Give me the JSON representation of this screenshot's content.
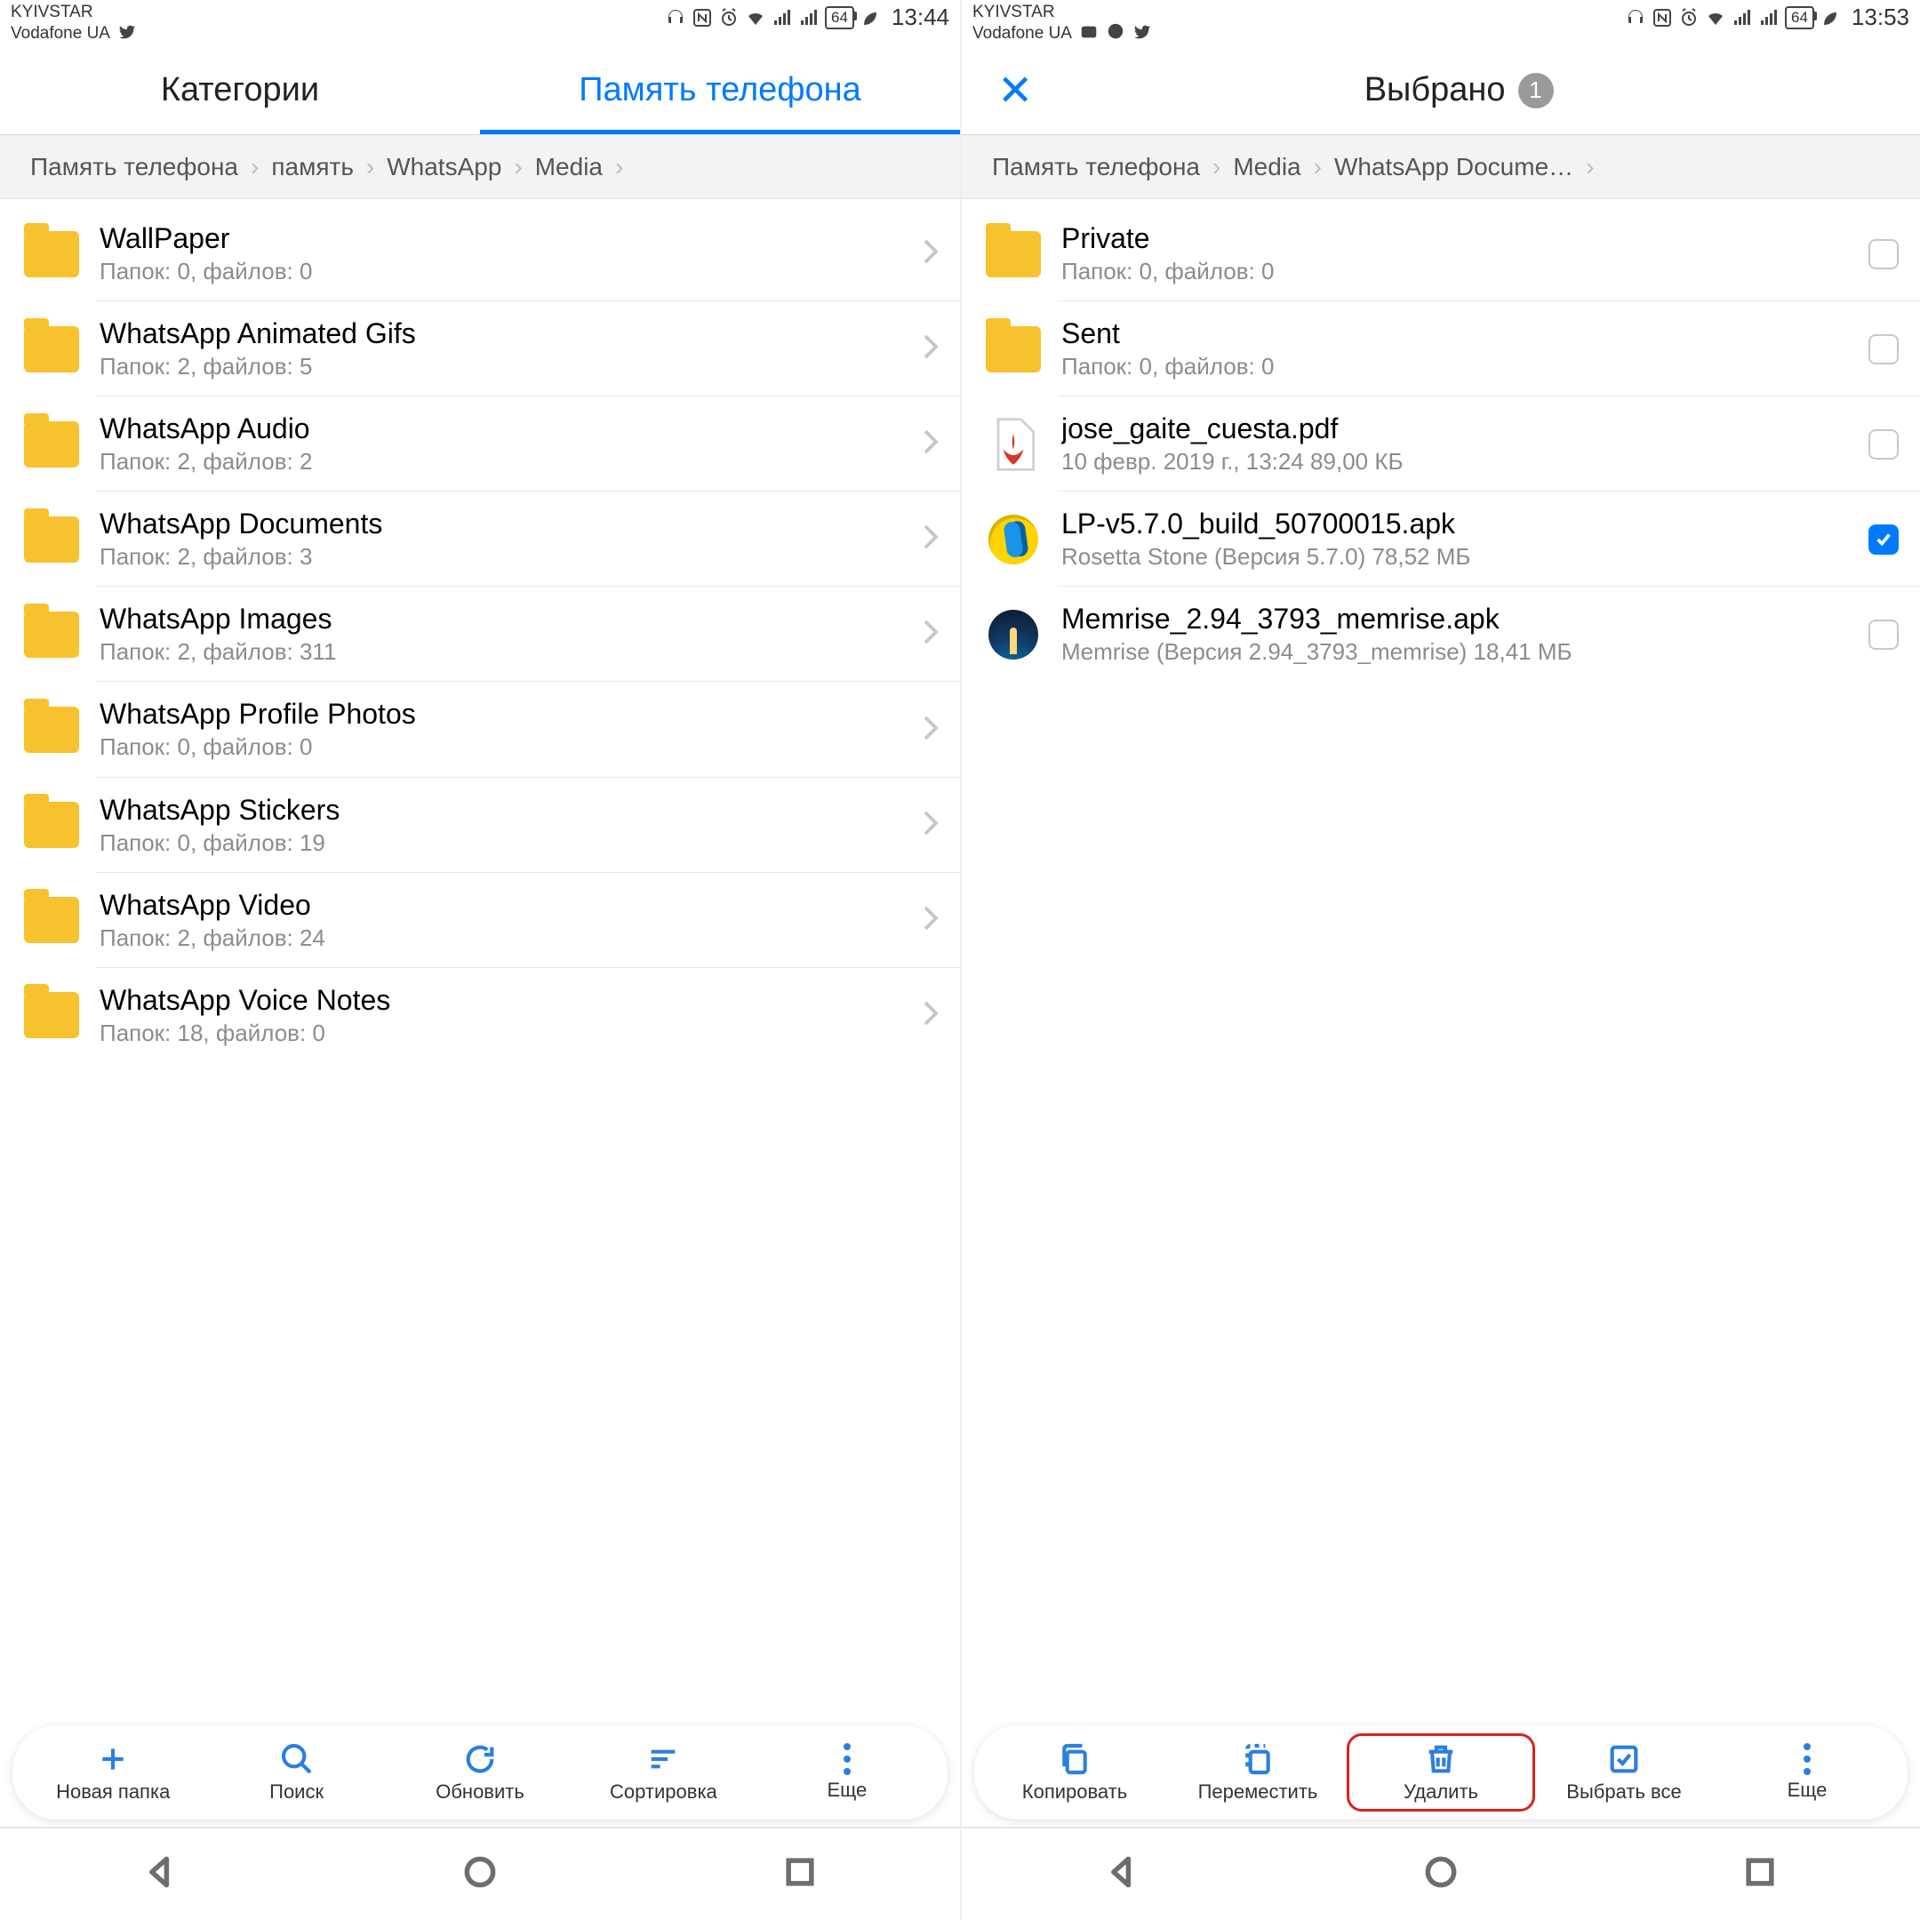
{
  "left": {
    "status": {
      "carrier1": "KYIVSTAR",
      "carrier2": "Vodafone UA",
      "battery": "64",
      "time": "13:44"
    },
    "tabs": {
      "categories": "Категории",
      "storage": "Память телефона"
    },
    "breadcrumb": [
      "Память телефона",
      "память",
      "WhatsApp",
      "Media"
    ],
    "items": [
      {
        "name": "WallPaper",
        "sub": "Папок: 0, файлов: 0"
      },
      {
        "name": "WhatsApp Animated Gifs",
        "sub": "Папок: 2, файлов: 5"
      },
      {
        "name": "WhatsApp Audio",
        "sub": "Папок: 2, файлов: 2"
      },
      {
        "name": "WhatsApp Documents",
        "sub": "Папок: 2, файлов: 3"
      },
      {
        "name": "WhatsApp Images",
        "sub": "Папок: 2, файлов: 311"
      },
      {
        "name": "WhatsApp Profile Photos",
        "sub": "Папок: 0, файлов: 0"
      },
      {
        "name": "WhatsApp Stickers",
        "sub": "Папок: 0, файлов: 19"
      },
      {
        "name": "WhatsApp Video",
        "sub": "Папок: 2, файлов: 24"
      },
      {
        "name": "WhatsApp Voice Notes",
        "sub": "Папок: 18, файлов: 0"
      }
    ],
    "toolbar": {
      "new_folder": "Новая папка",
      "search": "Поиск",
      "refresh": "Обновить",
      "sort": "Сортировка",
      "more": "Еще"
    }
  },
  "right": {
    "status": {
      "carrier1": "KYIVSTAR",
      "carrier2": "Vodafone UA",
      "battery": "64",
      "time": "13:53"
    },
    "header": {
      "title": "Выбрано",
      "count": "1"
    },
    "breadcrumb": [
      "Память телефона",
      "Media",
      "WhatsApp Docume…"
    ],
    "items": [
      {
        "type": "folder",
        "name": "Private",
        "sub": "Папок: 0, файлов: 0",
        "checked": false
      },
      {
        "type": "folder",
        "name": "Sent",
        "sub": "Папок: 0, файлов: 0",
        "checked": false
      },
      {
        "type": "pdf",
        "name": "jose_gaite_cuesta.pdf",
        "sub": "10 февр. 2019 г., 13:24 89,00 КБ",
        "checked": false
      },
      {
        "type": "app1",
        "name": "LP-v5.7.0_build_50700015.apk",
        "sub": "Rosetta Stone (Версия 5.7.0) 78,52 МБ",
        "checked": true
      },
      {
        "type": "app2",
        "name": "Memrise_2.94_3793_memrise.apk",
        "sub": "Memrise (Версия 2.94_3793_memrise) 18,41 МБ",
        "checked": false
      }
    ],
    "toolbar": {
      "copy": "Копировать",
      "move": "Переместить",
      "delete": "Удалить",
      "select_all": "Выбрать все",
      "more": "Еще"
    }
  }
}
